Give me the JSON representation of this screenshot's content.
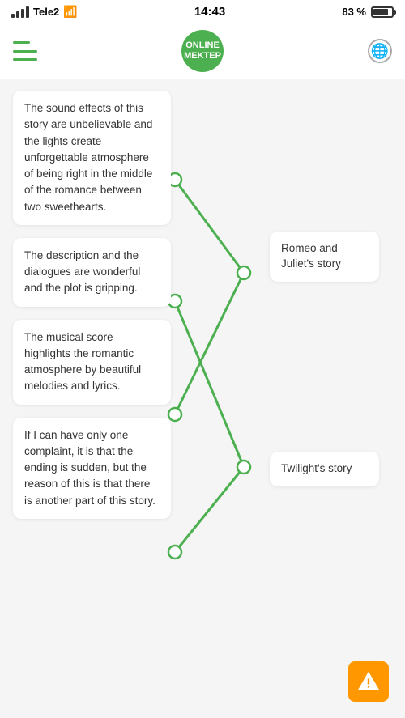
{
  "statusBar": {
    "carrier": "Tele2",
    "time": "14:43",
    "battery": "83 %"
  },
  "header": {
    "logoLine1": "ONLINE",
    "logoLine2": "MEKTEP",
    "menuLabel": "menu"
  },
  "cards": [
    {
      "id": "card-1",
      "text": "The sound effects of this story are unbelievable and the lights create unforgettable atmosphere of being right in the middle of the romance between two sweethearts."
    },
    {
      "id": "card-2",
      "text": "The description and the dialogues are wonderful and the plot is gripping."
    },
    {
      "id": "card-3",
      "text": "The musical score highlights the romantic atmosphere by beautiful melodies and lyrics."
    },
    {
      "id": "card-4",
      "text": "If I can have only one complaint, it is that the ending is sudden, but the reason of this is that there is another part of this story."
    }
  ],
  "labels": [
    {
      "id": "label-1",
      "text": "Romeo and Juliet's story"
    },
    {
      "id": "label-2",
      "text": "Twilight's story"
    }
  ],
  "warningBtn": {
    "label": "warning"
  },
  "accentColor": "#4caf50",
  "warningColor": "#ff9800"
}
